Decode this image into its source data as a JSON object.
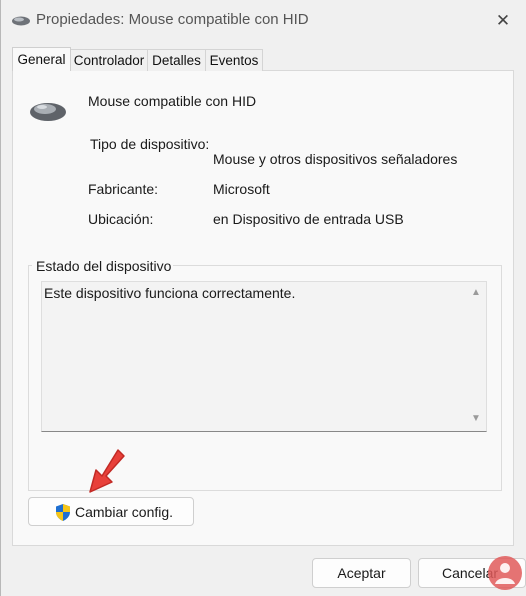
{
  "window": {
    "title": "Propiedades: Mouse compatible con HID",
    "close_glyph": "✕"
  },
  "tabs": [
    {
      "label": "General",
      "active": true
    },
    {
      "label": "Controlador",
      "active": false
    },
    {
      "label": "Detalles",
      "active": false
    },
    {
      "label": "Eventos",
      "active": false
    }
  ],
  "device": {
    "icon": "mouse-icon",
    "name": "Mouse compatible con HID",
    "type_label": "Tipo de dispositivo:",
    "type_value": "Mouse y otros dispositivos señaladores",
    "manufacturer_label": "Fabricante:",
    "manufacturer_value": "Microsoft",
    "location_label": "Ubicación:",
    "location_value": "en Dispositivo de entrada USB"
  },
  "status": {
    "group_title": "Estado del dispositivo",
    "text": "Este dispositivo funciona correctamente."
  },
  "buttons": {
    "change_settings": "Cambiar config.",
    "ok": "Aceptar",
    "cancel": "Cancelar"
  },
  "colors": {
    "arrow": "#e8403a",
    "shield_blue": "#1f6fd1",
    "shield_yellow": "#f5c518"
  }
}
